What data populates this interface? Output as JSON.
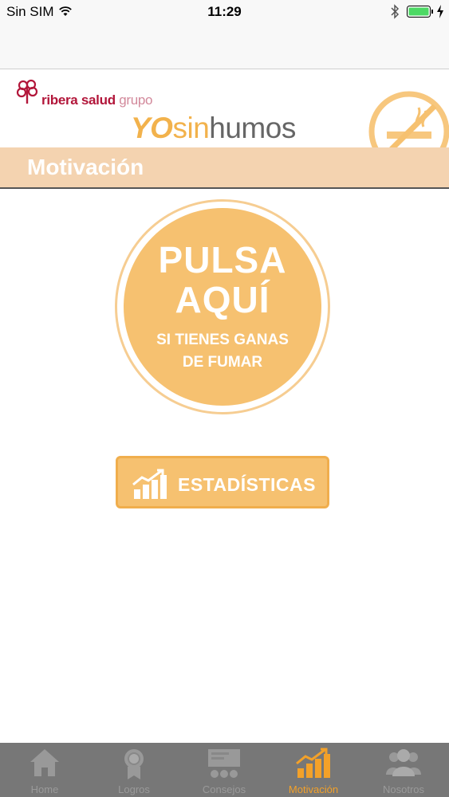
{
  "status_bar": {
    "carrier": "Sin SIM",
    "time": "11:29",
    "icons": [
      "wifi-icon",
      "bluetooth-icon",
      "battery-icon",
      "charging-icon"
    ]
  },
  "header": {
    "logo_brand_bold": "ribera salud",
    "logo_brand_light": "grupo",
    "app_title_yo": "YO",
    "app_title_sin": "sin",
    "app_title_humos": "humos",
    "no_smoking_icon": "no-smoking-icon",
    "section_title": "Motivación"
  },
  "main": {
    "pulsa_line1": "PULSA",
    "pulsa_line2": "AQUÍ",
    "pulsa_sub_line1": "SI TIENES GANAS",
    "pulsa_sub_line2": "DE FUMAR",
    "stats_label": "ESTADÍSTICAS",
    "stats_icon": "bar-chart-icon"
  },
  "tab_bar": {
    "active_index": 3,
    "tabs": [
      {
        "label": "Home",
        "icon": "home-icon"
      },
      {
        "label": "Logros",
        "icon": "medal-icon"
      },
      {
        "label": "Consejos",
        "icon": "board-icon"
      },
      {
        "label": "Motivación",
        "icon": "bar-chart-icon"
      },
      {
        "label": "Nosotros",
        "icon": "people-icon"
      }
    ]
  },
  "colors": {
    "accent": "#f6c170",
    "accent_border": "#f0ae4d",
    "section_band": "#f4d3b0",
    "tab_active": "#f3a129",
    "tab_bar_bg": "#777777",
    "brand_red": "#b2163a"
  }
}
